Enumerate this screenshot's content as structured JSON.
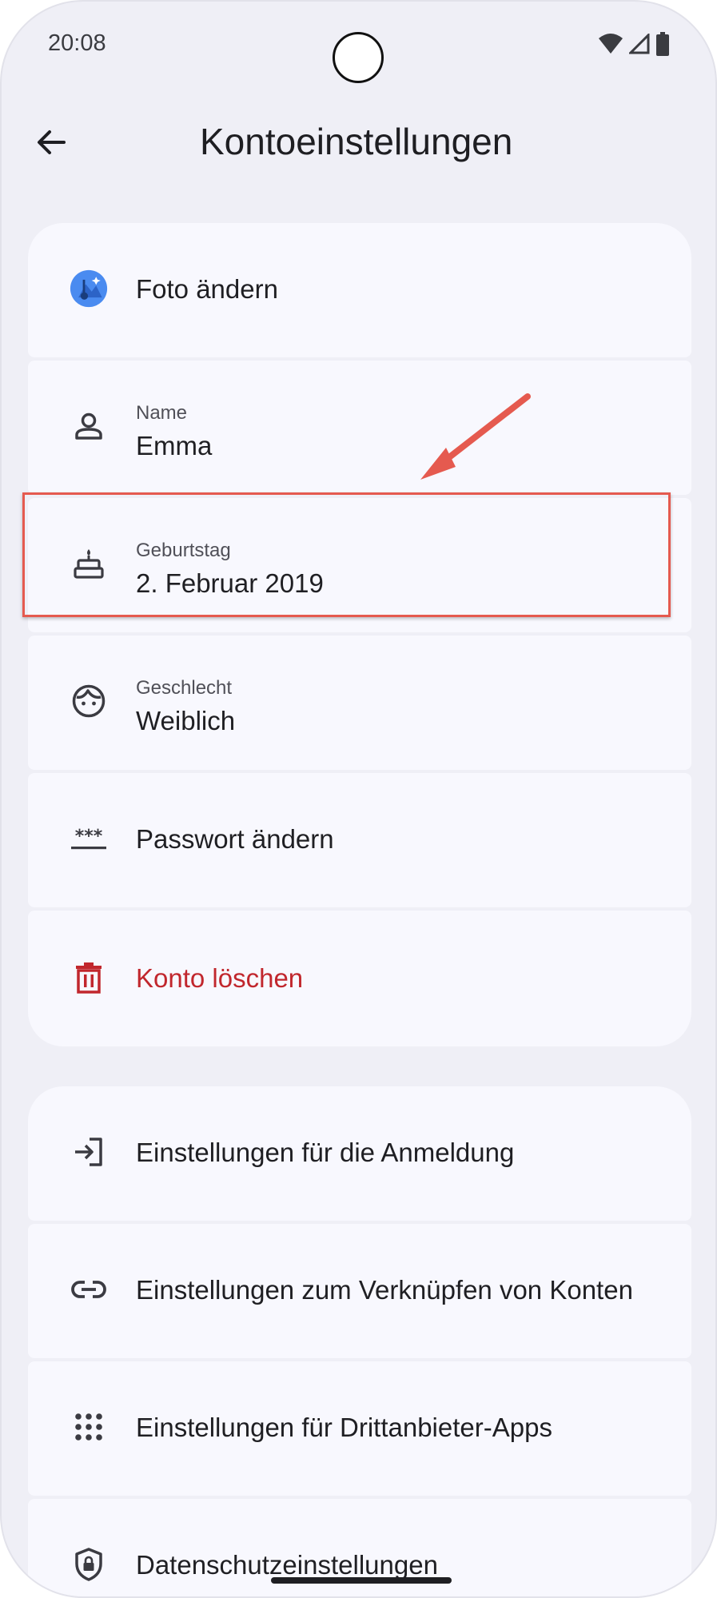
{
  "status_bar": {
    "time": "20:08"
  },
  "app_bar": {
    "title": "Kontoeinstellungen"
  },
  "account_items": [
    {
      "id": "photo",
      "label": "Foto ändern"
    },
    {
      "id": "name",
      "label": "Name",
      "value": "Emma"
    },
    {
      "id": "birthday",
      "label": "Geburtstag",
      "value": "2. Februar 2019"
    },
    {
      "id": "gender",
      "label": "Geschlecht",
      "value": "Weiblich"
    },
    {
      "id": "password",
      "label": "Passwort ändern"
    },
    {
      "id": "delete",
      "label": "Konto löschen"
    }
  ],
  "settings_items": [
    {
      "id": "signin",
      "label": "Einstellungen für die Anmeldung"
    },
    {
      "id": "linked",
      "label": "Einstellungen zum Verknüpfen von Konten"
    },
    {
      "id": "thirdparty",
      "label": "Einstellungen für Drittanbieter-Apps"
    },
    {
      "id": "privacy",
      "label": "Datenschutzeinstellungen"
    }
  ],
  "colors": {
    "danger": "#c1272d",
    "highlight": "#e55a4f",
    "photo_badge": "#4285f4"
  }
}
